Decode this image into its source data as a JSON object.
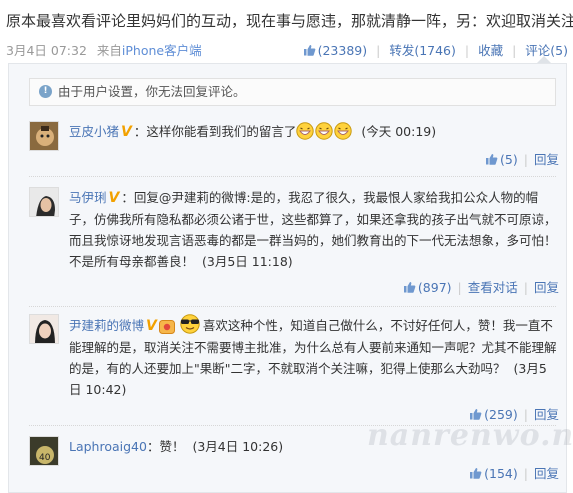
{
  "post": {
    "text": "原本最喜欢看评论里妈妈们的互动，现在事与愿违，那就清静一阵，另：欢迎取消关注！",
    "date": "3月4日 07:32",
    "from_prefix": "来自",
    "client": "iPhone客户端",
    "likes": "(23389)",
    "repost": "转发(1746)",
    "favorite": "收藏",
    "comments": "评论(5)"
  },
  "notice": {
    "text": "由于用户设置，你无法回复评论。"
  },
  "comments": [
    {
      "user": "豆皮小猪",
      "text": "：这样你能看到我们的留言了",
      "time": "(今天 00:19)",
      "likes": "(5)",
      "reply": "回复"
    },
    {
      "user": "马伊琍",
      "text": "：回复@尹建莉的微博:是的，我忍了很久，我最恨人家给我扣公众人物的帽子，仿佛我所有隐私都必须公诸于世，这些都算了，如果还拿我的孩子出气就不可原谅，而且我惊讶地发现言语恶毒的都是一群当妈的，她们教育出的下一代无法想象，多可怕！不是所有母亲都善良！",
      "time": "(3月5日 11:18)",
      "likes": "(897)",
      "view_dialog": "查看对话",
      "reply": "回复"
    },
    {
      "user": "尹建莉的微博",
      "text": "喜欢这种个性，知道自己做什么，不讨好任何人，赞！我一直不能理解的是，取消关注不需要博主批准，为什么总有人要前来通知一声呢？尤其不能理解的是，有的人还要加上\"果断\"二字，不就取消个关注嘛，犯得上使那么大劲吗？",
      "time": "(3月5日 10:42)",
      "likes": "(259)",
      "reply": "回复"
    },
    {
      "user": "Laphroaig40",
      "text": "：赞！",
      "time": "(3月4日 10:26)",
      "likes": "(154)",
      "reply": "回复"
    }
  ],
  "watermark": "nanrenwo.net",
  "colors": {
    "link": "#4a75b5",
    "meta": "#999999",
    "badge": "#f2a100",
    "panel": "#f5f7fa"
  }
}
